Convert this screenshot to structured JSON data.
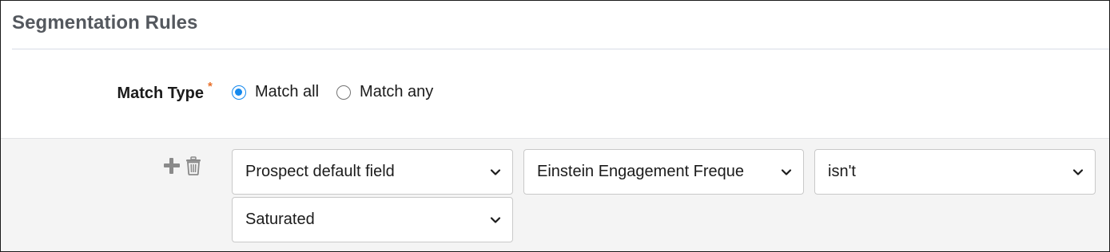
{
  "header": {
    "title": "Segmentation Rules"
  },
  "match_type": {
    "label": "Match Type",
    "required_mark": "*",
    "options": [
      {
        "label": "Match all",
        "selected": true
      },
      {
        "label": "Match any",
        "selected": false
      }
    ]
  },
  "rule": {
    "actions": {
      "add_icon": "plus-icon",
      "delete_icon": "trash-icon"
    },
    "field_type": "Prospect default field",
    "field_name": "Einstein Engagement Freque",
    "operator": "isn't",
    "value": "Saturated"
  },
  "colors": {
    "accent": "#1589ee",
    "required": "#e8702a",
    "rule_background": "#f4f4f4"
  }
}
